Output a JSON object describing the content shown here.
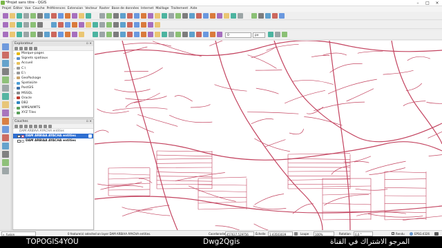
{
  "window": {
    "title": "*Projet sans titre - QGIS"
  },
  "menubar": {
    "items": [
      "Projet",
      "Éditer",
      "Vue",
      "Couche",
      "Préférences",
      "Extension",
      "Vecteur",
      "Raster",
      "Base de données",
      "Internet",
      "Maillage",
      "Traitement",
      "Aide"
    ]
  },
  "toolbar": {
    "scale_value": "0",
    "unit": "px"
  },
  "browser_panel": {
    "title": "Explorateur",
    "items": [
      {
        "label": "Marque-pages",
        "icon": "star-icon",
        "color": "#e6b800"
      },
      {
        "label": "Signets spatiaux",
        "icon": "bookmark-icon",
        "color": "#5b8fc9"
      },
      {
        "label": "Accueil",
        "icon": "folder-icon",
        "color": "#e8c15a"
      },
      {
        "label": "C:\\",
        "icon": "drive-icon",
        "color": "#9a9a9a"
      },
      {
        "label": "E:\\",
        "icon": "drive-icon",
        "color": "#9a9a9a"
      },
      {
        "label": "GeoPackage",
        "icon": "geopackage-icon",
        "color": "#c9a36b"
      },
      {
        "label": "SpatiaLite",
        "icon": "spatialite-icon",
        "color": "#4d9fd6"
      },
      {
        "label": "PostGIS",
        "icon": "postgis-icon",
        "color": "#3b6fa8"
      },
      {
        "label": "MSSQL",
        "icon": "mssql-icon",
        "color": "#8a8a8a"
      },
      {
        "label": "Oracle",
        "icon": "oracle-icon",
        "color": "#c0392b"
      },
      {
        "label": "DB2",
        "icon": "db2-icon",
        "color": "#2e86c1"
      },
      {
        "label": "WMS/WMTS",
        "icon": "wms-icon",
        "color": "#5aa05a"
      },
      {
        "label": "XYZ Tiles",
        "icon": "xyz-icon",
        "color": "#5aa05a"
      }
    ]
  },
  "layers_panel": {
    "title": "Couches",
    "group_label": "DAM ARBIAA AYACHA entities",
    "layers": [
      {
        "label": "DAM ARBIAA AYACHA entities",
        "checked": true,
        "selected": true,
        "color": "#c0506a"
      },
      {
        "label": "DAM ARBIAA AYACHA entities",
        "checked": false,
        "selected": false,
        "color": "#9a9a9a"
      }
    ]
  },
  "statusbar": {
    "search_placeholder": "Taper pour localiser (Ctrl+K)",
    "search_value": "fusion",
    "message": "0 feature(s) selected on layer DAM ARBIAA AYACHA entities.",
    "coord_label": "Coordonnée",
    "coord_value": "457637,529756",
    "scale_label": "Échelle",
    "scale_value": "1:43503039",
    "magnifier_label": "Loupe",
    "magnifier_value": "100%",
    "rotation_label": "Rotation",
    "rotation_value": "0,0 °",
    "render_label": "Rendu",
    "crs_label": "EPSG:4326"
  },
  "banner": {
    "left": "TOPOGIS4YOU",
    "center": "Dwg2Qgis",
    "right": "المرجو الاشتراك في القناة"
  },
  "map": {
    "line_color": "#c3435f",
    "background": "#ffffff"
  }
}
